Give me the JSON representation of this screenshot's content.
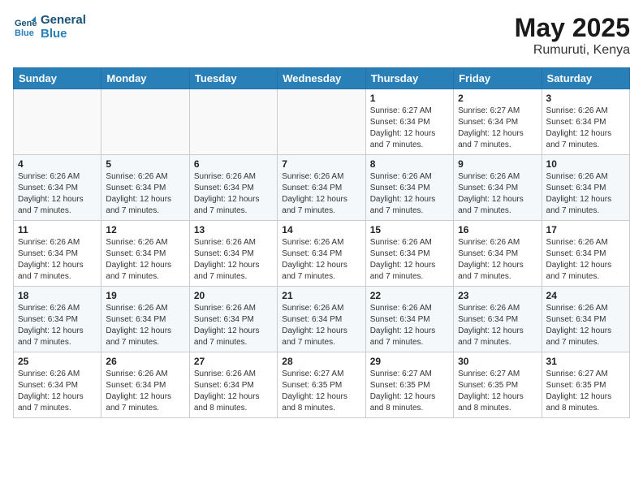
{
  "header": {
    "logo_line1": "General",
    "logo_line2": "Blue",
    "title": "May 2025",
    "location": "Rumuruti, Kenya"
  },
  "days_of_week": [
    "Sunday",
    "Monday",
    "Tuesday",
    "Wednesday",
    "Thursday",
    "Friday",
    "Saturday"
  ],
  "weeks": [
    [
      {
        "day": "",
        "info": ""
      },
      {
        "day": "",
        "info": ""
      },
      {
        "day": "",
        "info": ""
      },
      {
        "day": "",
        "info": ""
      },
      {
        "day": "1",
        "info": "Sunrise: 6:27 AM\nSunset: 6:34 PM\nDaylight: 12 hours\nand 7 minutes."
      },
      {
        "day": "2",
        "info": "Sunrise: 6:27 AM\nSunset: 6:34 PM\nDaylight: 12 hours\nand 7 minutes."
      },
      {
        "day": "3",
        "info": "Sunrise: 6:26 AM\nSunset: 6:34 PM\nDaylight: 12 hours\nand 7 minutes."
      }
    ],
    [
      {
        "day": "4",
        "info": "Sunrise: 6:26 AM\nSunset: 6:34 PM\nDaylight: 12 hours\nand 7 minutes."
      },
      {
        "day": "5",
        "info": "Sunrise: 6:26 AM\nSunset: 6:34 PM\nDaylight: 12 hours\nand 7 minutes."
      },
      {
        "day": "6",
        "info": "Sunrise: 6:26 AM\nSunset: 6:34 PM\nDaylight: 12 hours\nand 7 minutes."
      },
      {
        "day": "7",
        "info": "Sunrise: 6:26 AM\nSunset: 6:34 PM\nDaylight: 12 hours\nand 7 minutes."
      },
      {
        "day": "8",
        "info": "Sunrise: 6:26 AM\nSunset: 6:34 PM\nDaylight: 12 hours\nand 7 minutes."
      },
      {
        "day": "9",
        "info": "Sunrise: 6:26 AM\nSunset: 6:34 PM\nDaylight: 12 hours\nand 7 minutes."
      },
      {
        "day": "10",
        "info": "Sunrise: 6:26 AM\nSunset: 6:34 PM\nDaylight: 12 hours\nand 7 minutes."
      }
    ],
    [
      {
        "day": "11",
        "info": "Sunrise: 6:26 AM\nSunset: 6:34 PM\nDaylight: 12 hours\nand 7 minutes."
      },
      {
        "day": "12",
        "info": "Sunrise: 6:26 AM\nSunset: 6:34 PM\nDaylight: 12 hours\nand 7 minutes."
      },
      {
        "day": "13",
        "info": "Sunrise: 6:26 AM\nSunset: 6:34 PM\nDaylight: 12 hours\nand 7 minutes."
      },
      {
        "day": "14",
        "info": "Sunrise: 6:26 AM\nSunset: 6:34 PM\nDaylight: 12 hours\nand 7 minutes."
      },
      {
        "day": "15",
        "info": "Sunrise: 6:26 AM\nSunset: 6:34 PM\nDaylight: 12 hours\nand 7 minutes."
      },
      {
        "day": "16",
        "info": "Sunrise: 6:26 AM\nSunset: 6:34 PM\nDaylight: 12 hours\nand 7 minutes."
      },
      {
        "day": "17",
        "info": "Sunrise: 6:26 AM\nSunset: 6:34 PM\nDaylight: 12 hours\nand 7 minutes."
      }
    ],
    [
      {
        "day": "18",
        "info": "Sunrise: 6:26 AM\nSunset: 6:34 PM\nDaylight: 12 hours\nand 7 minutes."
      },
      {
        "day": "19",
        "info": "Sunrise: 6:26 AM\nSunset: 6:34 PM\nDaylight: 12 hours\nand 7 minutes."
      },
      {
        "day": "20",
        "info": "Sunrise: 6:26 AM\nSunset: 6:34 PM\nDaylight: 12 hours\nand 7 minutes."
      },
      {
        "day": "21",
        "info": "Sunrise: 6:26 AM\nSunset: 6:34 PM\nDaylight: 12 hours\nand 7 minutes."
      },
      {
        "day": "22",
        "info": "Sunrise: 6:26 AM\nSunset: 6:34 PM\nDaylight: 12 hours\nand 7 minutes."
      },
      {
        "day": "23",
        "info": "Sunrise: 6:26 AM\nSunset: 6:34 PM\nDaylight: 12 hours\nand 7 minutes."
      },
      {
        "day": "24",
        "info": "Sunrise: 6:26 AM\nSunset: 6:34 PM\nDaylight: 12 hours\nand 7 minutes."
      }
    ],
    [
      {
        "day": "25",
        "info": "Sunrise: 6:26 AM\nSunset: 6:34 PM\nDaylight: 12 hours\nand 7 minutes."
      },
      {
        "day": "26",
        "info": "Sunrise: 6:26 AM\nSunset: 6:34 PM\nDaylight: 12 hours\nand 7 minutes."
      },
      {
        "day": "27",
        "info": "Sunrise: 6:26 AM\nSunset: 6:34 PM\nDaylight: 12 hours\nand 8 minutes."
      },
      {
        "day": "28",
        "info": "Sunrise: 6:27 AM\nSunset: 6:35 PM\nDaylight: 12 hours\nand 8 minutes."
      },
      {
        "day": "29",
        "info": "Sunrise: 6:27 AM\nSunset: 6:35 PM\nDaylight: 12 hours\nand 8 minutes."
      },
      {
        "day": "30",
        "info": "Sunrise: 6:27 AM\nSunset: 6:35 PM\nDaylight: 12 hours\nand 8 minutes."
      },
      {
        "day": "31",
        "info": "Sunrise: 6:27 AM\nSunset: 6:35 PM\nDaylight: 12 hours\nand 8 minutes."
      }
    ]
  ]
}
